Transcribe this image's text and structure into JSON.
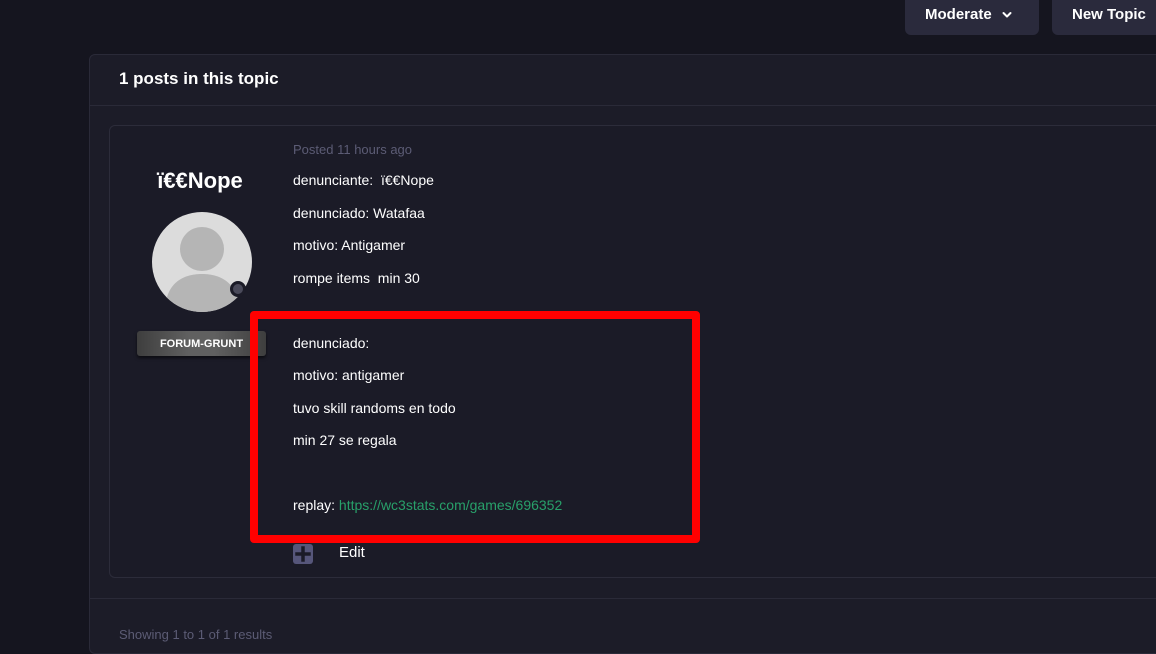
{
  "toolbar": {
    "moderate_label": "Moderate",
    "new_topic_label": "New Topic"
  },
  "topic": {
    "posts_count_label": "1 posts in this topic",
    "results_label": "Showing 1 to 1 of 1 results"
  },
  "post": {
    "author": "ï€€Nope",
    "rank": "FORUM-GRUNT",
    "posted": "Posted 11 hours ago",
    "lines": [
      "denunciante:  ï€€Nope",
      "denunciado: Watafaa",
      "motivo: Antigamer",
      "rompe items  min 30",
      "denunciado:",
      "motivo: antigamer",
      "tuvo skill randoms en todo",
      "min 27 se regala"
    ],
    "replay_label": "replay: ",
    "replay_url": "https://wc3stats.com/games/696352",
    "edit_label": "Edit"
  },
  "colors": {
    "background": "#15151f",
    "panel": "#1c1c28",
    "highlight": "#ff0000",
    "link": "#28a06a",
    "muted": "#5c5c75"
  },
  "icons": {
    "moderate": "chevron-down-icon",
    "avatar": "user-silhouette-icon",
    "plus": "plus-square-icon"
  }
}
